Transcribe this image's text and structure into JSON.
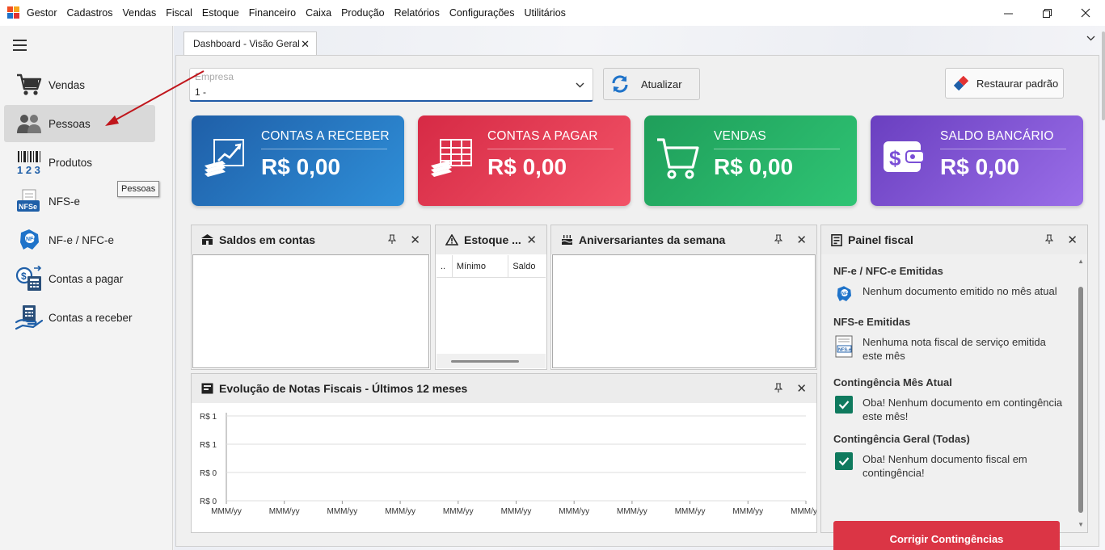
{
  "app": {
    "menu": [
      "Gestor",
      "Cadastros",
      "Vendas",
      "Fiscal",
      "Estoque",
      "Financeiro",
      "Caixa",
      "Produção",
      "Relatórios",
      "Configurações",
      "Utilitários"
    ]
  },
  "sidebar": {
    "items": [
      {
        "label": "Vendas",
        "icon": "cart-icon"
      },
      {
        "label": "Pessoas",
        "icon": "people-icon",
        "active": true
      },
      {
        "label": "Produtos",
        "icon": "barcode-icon"
      },
      {
        "label": "NFS-e",
        "icon": "nfse-icon"
      },
      {
        "label": "NF-e / NFC-e",
        "icon": "nfe-icon"
      },
      {
        "label": "Contas a pagar",
        "icon": "payables-icon"
      },
      {
        "label": "Contas a receber",
        "icon": "receivables-icon"
      }
    ],
    "tooltip": "Pessoas"
  },
  "tab": {
    "label": "Dashboard - Visão Geral"
  },
  "toolbar": {
    "empresa_label": "Empresa",
    "empresa_value": "1 -",
    "atualizar": "Atualizar",
    "restaurar": "Restaurar padrão"
  },
  "cards": [
    {
      "title": "CONTAS A RECEBER",
      "value": "R$ 0,00",
      "color_from": "#1f5fa8",
      "color_to": "#2f8fd8"
    },
    {
      "title": "CONTAS A PAGAR",
      "value": "R$ 0,00",
      "color_from": "#d62a45",
      "color_to": "#f25367"
    },
    {
      "title": "VENDAS",
      "value": "R$ 0,00",
      "color_from": "#1f9e5a",
      "color_to": "#2fc474"
    },
    {
      "title": "SALDO BANCÁRIO",
      "value": "R$ 0,00",
      "color_from": "#6a3fc0",
      "color_to": "#9a6ee8"
    }
  ],
  "panels": {
    "saldos": {
      "title": "Saldos em contas"
    },
    "estoque": {
      "title": "Estoque ...",
      "columns": [
        "..",
        "Mínimo",
        "Saldo"
      ]
    },
    "aniversariantes": {
      "title": "Aniversariantes da semana"
    },
    "evolucao": {
      "title": "Evolução de Notas Fiscais - Últimos 12 meses"
    },
    "fiscal": {
      "title": "Painel fiscal",
      "sections": [
        {
          "heading": "NF-e / NFC-e Emitidas",
          "text": "Nenhum documento emitido no mês atual",
          "icon": "nfe-icon"
        },
        {
          "heading": "NFS-e Emitidas",
          "text": "Nenhuma nota fiscal de serviço emitida este mês",
          "icon": "nfse-doc-icon"
        },
        {
          "heading": "Contingência Mês Atual",
          "text": "Oba! Nenhum documento em contingência este mês!",
          "icon": "check-icon"
        },
        {
          "heading": "Contingência Geral (Todas)",
          "text": "Oba! Nenhum documento fiscal em contingência!",
          "icon": "check-icon"
        }
      ],
      "button": "Corrigir Contingências"
    }
  },
  "chart_data": {
    "type": "line",
    "title": "Evolução de Notas Fiscais - Últimos 12 meses",
    "y_tick_labels": [
      "R$ 1",
      "R$ 1",
      "R$ 0",
      "R$ 0"
    ],
    "x_tick_labels": [
      "MMM/yy",
      "MMM/yy",
      "MMM/yy",
      "MMM/yy",
      "MMM/yy",
      "MMM/yy",
      "MMM/yy",
      "MMM/yy",
      "MMM/yy",
      "MMM/yy",
      "MMM/yy"
    ],
    "series": [],
    "grid": true
  }
}
